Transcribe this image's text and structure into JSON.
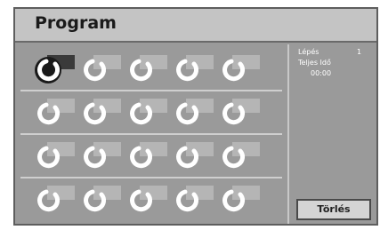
{
  "window": {
    "title": "Program"
  },
  "info": {
    "step_label": "Lépés",
    "step_value": "1",
    "total_time_label": "Teljes Idő",
    "total_time_value": "00:00"
  },
  "actions": {
    "clear_label": "Törlés"
  },
  "track_grid": {
    "rows": 4,
    "columns": 5,
    "selected_index": 0
  },
  "icons": {
    "track_slot": "disc-icon"
  }
}
